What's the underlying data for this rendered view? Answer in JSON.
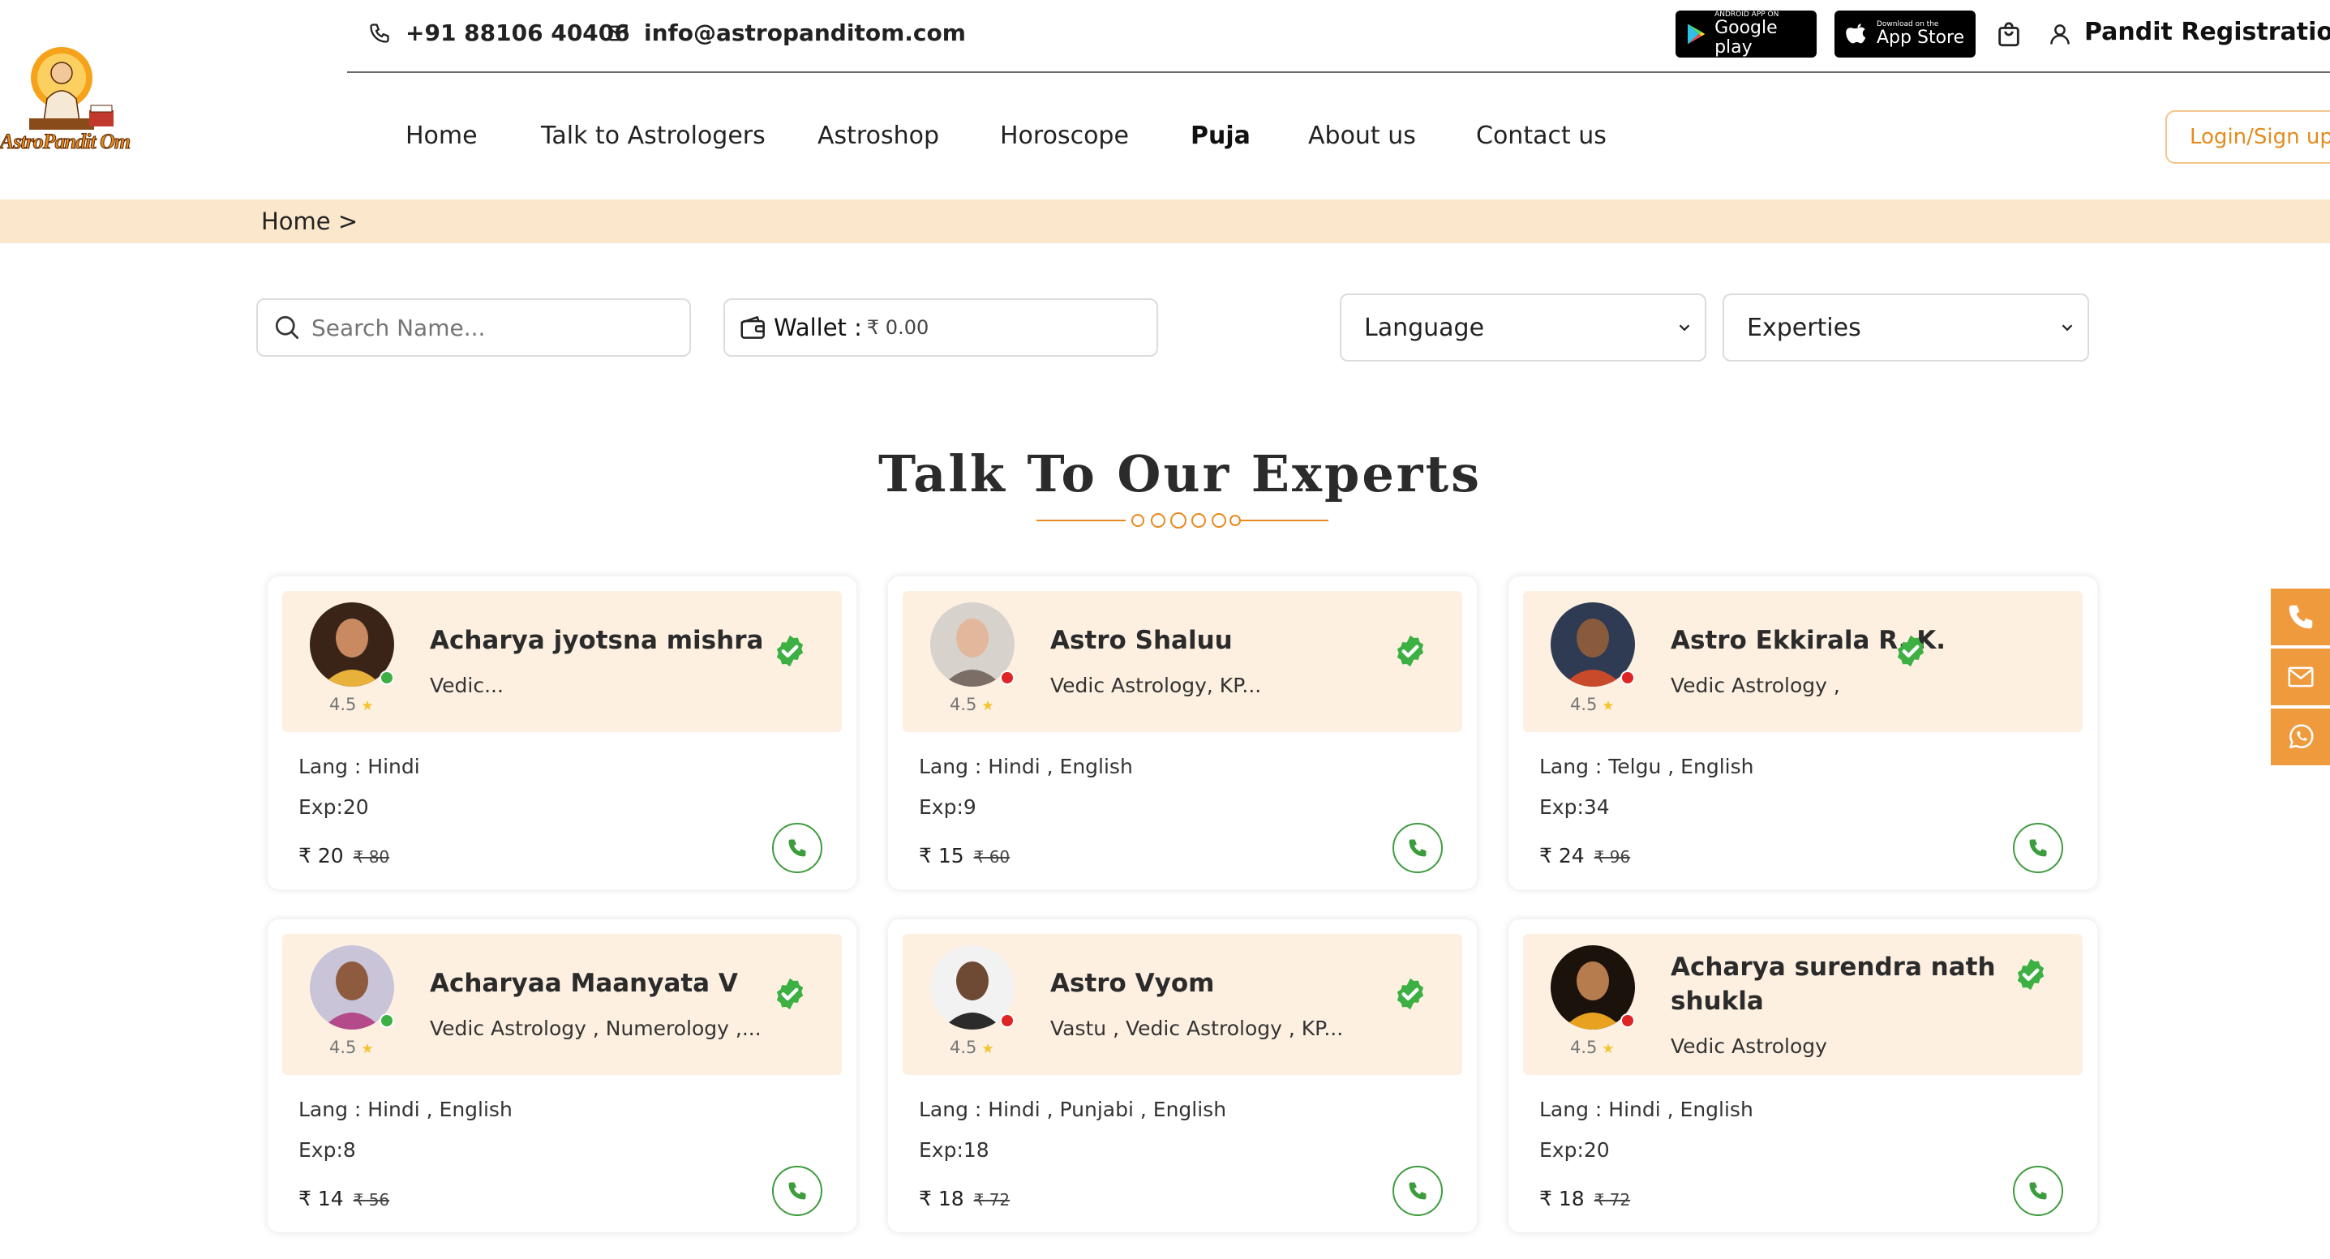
{
  "logo": {
    "text": "AstroPandit Om"
  },
  "topbar": {
    "phone": "+91 88106 40406",
    "email": "info@astropanditom.com",
    "google_play": {
      "small": "ANDROID APP ON",
      "big": "Google play"
    },
    "app_store": {
      "small": "Download on the",
      "big": "App Store"
    },
    "pandit_registration": "Pandit Registration"
  },
  "nav": {
    "items": [
      "Home",
      "Talk to Astrologers",
      "Astroshop",
      "Horoscope",
      "Puja",
      "About us",
      "Contact us"
    ],
    "login": "Login/Sign up"
  },
  "breadcrumb": "Home >",
  "filters": {
    "search_placeholder": "Search Name...",
    "wallet_label": "Wallet :",
    "wallet_amount": "₹ 0.00",
    "language": "Language",
    "experties": "Experties"
  },
  "section_title": "Talk To Our Experts",
  "astrologers": [
    {
      "name": "Acharya jyotsna mishra",
      "skills": "Vedic...",
      "rating": "4.5",
      "online": true,
      "lang": "Lang : Hindi",
      "exp": "Exp:20",
      "price": "₹ 20",
      "old_price": "₹ 80",
      "colors": {
        "bg": "#3a2418",
        "skin": "#c98a62",
        "cloth": "#e7b13a"
      }
    },
    {
      "name": "Astro Shaluu",
      "skills": "Vedic Astrology, KP...",
      "rating": "4.5",
      "online": false,
      "lang": "Lang : Hindi , English",
      "exp": "Exp:9",
      "price": "₹ 15",
      "old_price": "₹ 60",
      "colors": {
        "bg": "#d8d2cc",
        "skin": "#e2b79c",
        "cloth": "#7a6e66"
      }
    },
    {
      "name": "Astro Ekkirala R. K.",
      "skills": "Vedic Astrology ,",
      "rating": "4.5",
      "online": false,
      "lang": "Lang : Telgu , English",
      "exp": "Exp:34",
      "price": "₹ 24",
      "old_price": "₹ 96",
      "colors": {
        "bg": "#2f3b52",
        "skin": "#8a5a3c",
        "cloth": "#c94a2a"
      }
    },
    {
      "name": "Acharyaa Maanyata V",
      "skills": "Vedic Astrology , Numerology ,...",
      "rating": "4.5",
      "online": true,
      "lang": "Lang : Hindi , English",
      "exp": "Exp:8",
      "price": "₹ 14",
      "old_price": "₹ 56",
      "colors": {
        "bg": "#c9c4d8",
        "skin": "#8f5b3e",
        "cloth": "#b44a8a"
      }
    },
    {
      "name": "Astro Vyom",
      "skills": "Vastu , Vedic Astrology , KP...",
      "rating": "4.5",
      "online": false,
      "lang": "Lang : Hindi , Punjabi , English",
      "exp": "Exp:18",
      "price": "₹ 18",
      "old_price": "₹ 72",
      "colors": {
        "bg": "#f2f2f2",
        "skin": "#6e4a34",
        "cloth": "#2b2b2b"
      }
    },
    {
      "name": "Acharya surendra nath shukla",
      "skills": "Vedic Astrology",
      "rating": "4.5",
      "online": false,
      "lang": "Lang : Hindi , English",
      "exp": "Exp:20",
      "price": "₹ 18",
      "old_price": "₹ 72",
      "colors": {
        "bg": "#1c120c",
        "skin": "#b67c4e",
        "cloth": "#e8a21f"
      }
    }
  ],
  "colors": {
    "accent": "#f09a3e",
    "breadcrumb_bg": "#fbe7cb",
    "card_head_bg": "#fdf0e1",
    "online": "#3cb043",
    "offline": "#e02424",
    "call_green": "#3d9c3d"
  }
}
